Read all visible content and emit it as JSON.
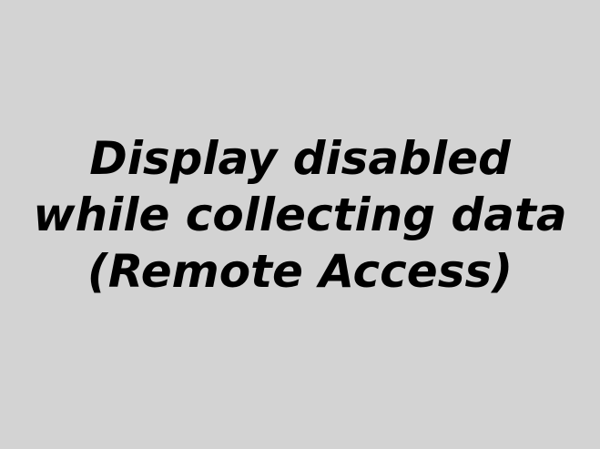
{
  "screen": {
    "background_color": "#d3d3d3",
    "text_color": "#000000",
    "message_lines": [
      "Display disabled",
      "while collecting data",
      "(Remote Access)"
    ]
  }
}
